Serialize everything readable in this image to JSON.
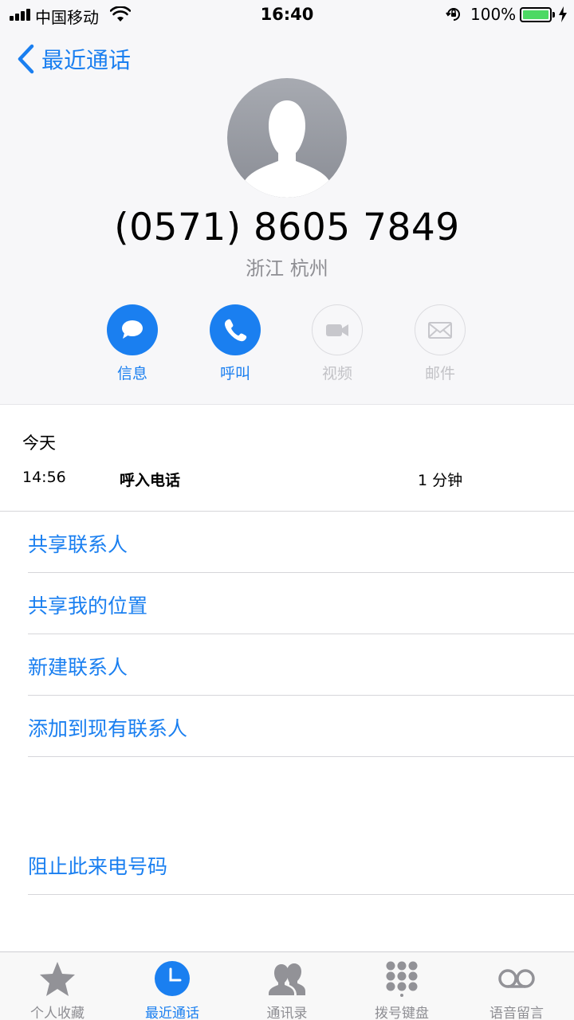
{
  "status": {
    "carrier": "中国移动",
    "time": "16:40",
    "battery": "100%"
  },
  "nav": {
    "back_label": "最近通话"
  },
  "contact": {
    "number": "(0571) 8605 7849",
    "location": "浙江 杭州"
  },
  "actions": [
    {
      "label": "信息",
      "icon": "message-icon",
      "enabled": true
    },
    {
      "label": "呼叫",
      "icon": "phone-icon",
      "enabled": true
    },
    {
      "label": "视频",
      "icon": "video-icon",
      "enabled": false
    },
    {
      "label": "邮件",
      "icon": "mail-icon",
      "enabled": false
    }
  ],
  "call_log": {
    "day": "今天",
    "entries": [
      {
        "time": "14:56",
        "type": "呼入电话",
        "duration": "1 分钟"
      }
    ]
  },
  "menu": [
    {
      "label": "共享联系人"
    },
    {
      "label": "共享我的位置"
    },
    {
      "label": "新建联系人"
    },
    {
      "label": "添加到现有联系人"
    }
  ],
  "block": {
    "label": "阻止此来电号码"
  },
  "tabs": [
    {
      "label": "个人收藏",
      "icon": "star-icon"
    },
    {
      "label": "最近通话",
      "icon": "clock-icon"
    },
    {
      "label": "通讯录",
      "icon": "contacts-icon"
    },
    {
      "label": "拨号键盘",
      "icon": "keypad-icon"
    },
    {
      "label": "语音留言",
      "icon": "voicemail-icon"
    }
  ],
  "active_tab": "最近通话",
  "colors": {
    "accent": "#1a7ff0",
    "battery": "#4cd964",
    "disabled": "#c2c2c6",
    "secondary_text": "#8e8e93"
  }
}
